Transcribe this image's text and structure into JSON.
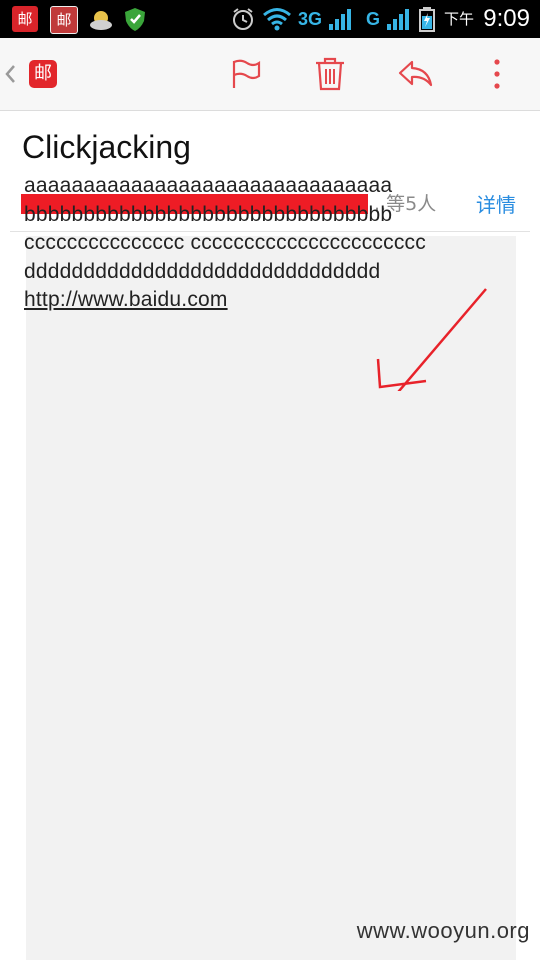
{
  "status_bar": {
    "app_badge_1": "邮",
    "app_badge_2": "邮",
    "network_3g": "3G",
    "network_g": "G",
    "ampm": "下午",
    "time": "9:09"
  },
  "action_bar": {
    "app_badge": "邮",
    "accent_color": "#e5484d"
  },
  "email": {
    "subject": "Clickjacking",
    "recipients_more": "...等5人",
    "details_label": "详情",
    "body_lines": [
      "aaaaaaaaaaaaaaaaaaaaaaaaaaaaaaa",
      "bbbbbbbbbbbbbbbbbbbbbbbbbbbbbbb",
      "ccccccccccccccc cccccccccccccccccccccc",
      "dddddddddddddddddddddddddddddd"
    ],
    "body_link": "http://www.baidu.com"
  },
  "watermark": "www.wooyun.org"
}
